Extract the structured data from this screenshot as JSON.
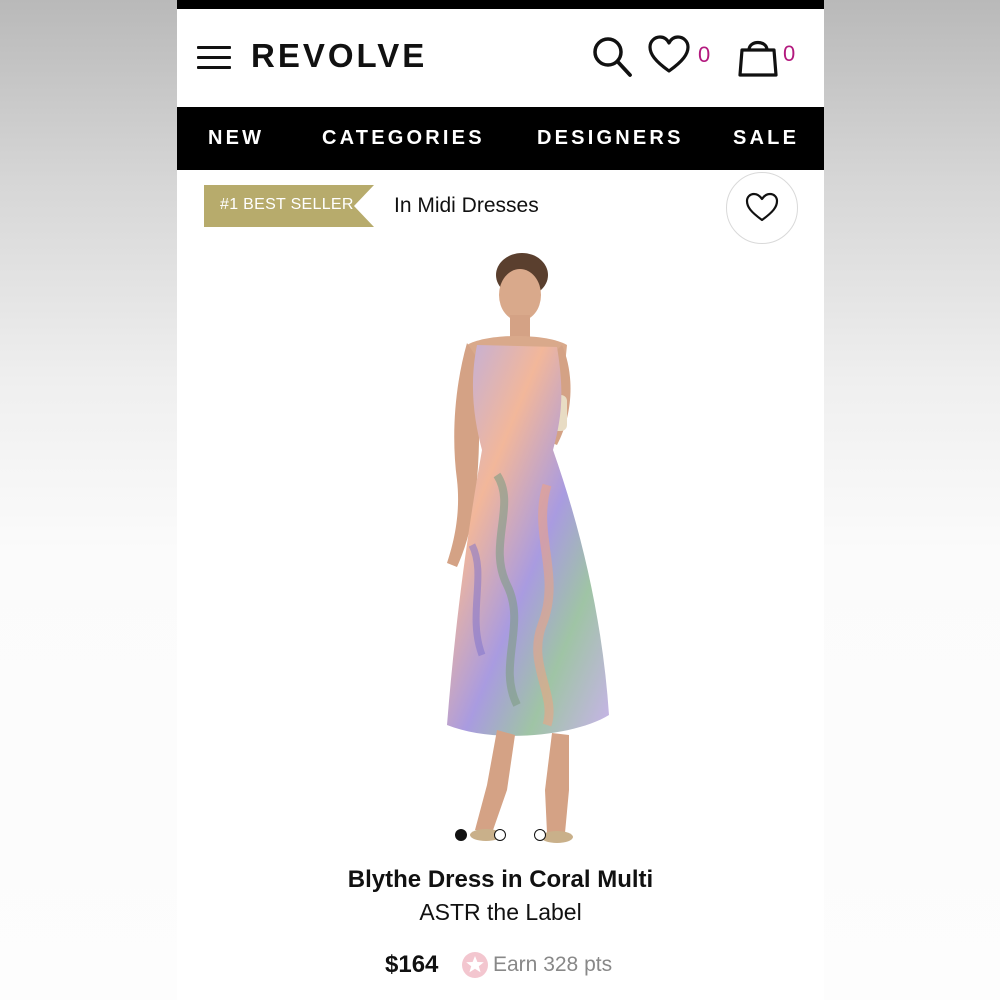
{
  "app": {
    "logo_text": "REVOLVE"
  },
  "header": {
    "icons": {
      "menu": "hamburger-menu-icon",
      "search": "search-icon",
      "wishlist": "heart-icon",
      "bag": "shopping-bag-icon"
    },
    "wishlist_count": "0",
    "bag_count": "0",
    "count_color": "#b3197e"
  },
  "nav": {
    "items": [
      {
        "label": "NEW"
      },
      {
        "label": "CATEGORIES"
      },
      {
        "label": "DESIGNERS"
      },
      {
        "label": "SALE"
      }
    ]
  },
  "badge": {
    "label": "#1 BEST SELLER",
    "category": "In Midi Dresses",
    "color": "#b7ab6c"
  },
  "product": {
    "name": "Blythe Dress in Coral Multi",
    "brand": "ASTR the Label",
    "price": "$164",
    "points": "Earn 328 pts",
    "image_slides": 3,
    "active_slide": 1
  },
  "colors": {
    "nav_bg": "#000000",
    "text": "#111111",
    "points_star": "#f3c6cf"
  }
}
